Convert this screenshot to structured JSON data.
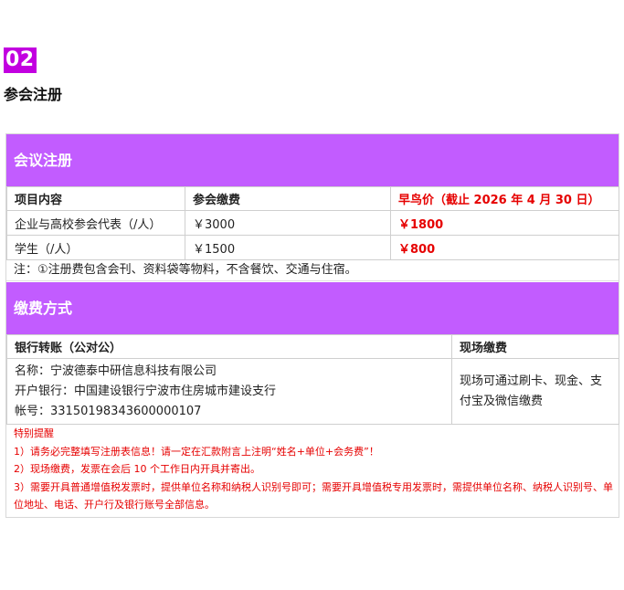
{
  "section": {
    "number": "02",
    "title": "参会注册"
  },
  "registration": {
    "heading": "会议注册",
    "columns": [
      "项目内容",
      "参会缴费",
      "早鸟价（截止 2026 年 4 月 30 日）"
    ],
    "rows": [
      {
        "item": "企业与高校参会代表（/人）",
        "fee": "￥3000",
        "early": "￥1800"
      },
      {
        "item": "学生（/人）",
        "fee": "￥1500",
        "early": "￥800"
      }
    ],
    "note": "注：①注册费包含会刊、资料袋等物料，不含餐饮、交通与住宿。"
  },
  "payment": {
    "heading": "缴费方式",
    "bank_header": "银行转账（公对公）",
    "onsite_header": "现场缴费",
    "bank_name": "名称：宁波德泰中研信息科技有限公司",
    "bank_branch": "开户银行：中国建设银行宁波市住房城市建设支行",
    "bank_account": "帐号：33150198343600000107",
    "onsite_text": "现场可通过刷卡、现金、支付宝及微信缴费"
  },
  "reminder": {
    "title": "特别提醒",
    "items": [
      "1）请务必完整填写注册表信息！请一定在汇款附言上注明“姓名+单位+会务费”！",
      "2）现场缴费，发票在会后 10 个工作日内开具并寄出。",
      "3）需要开具普通增值税发票时，提供单位名称和纳税人识别号即可；需要开具增值税专用发票时，需提供单位名称、纳税人识别号、单位地址、电话、开户行及银行账号全部信息。"
    ]
  },
  "colors": {
    "section_badge": "#c200e0",
    "band": "#c25cff",
    "highlight": "#e60000"
  }
}
